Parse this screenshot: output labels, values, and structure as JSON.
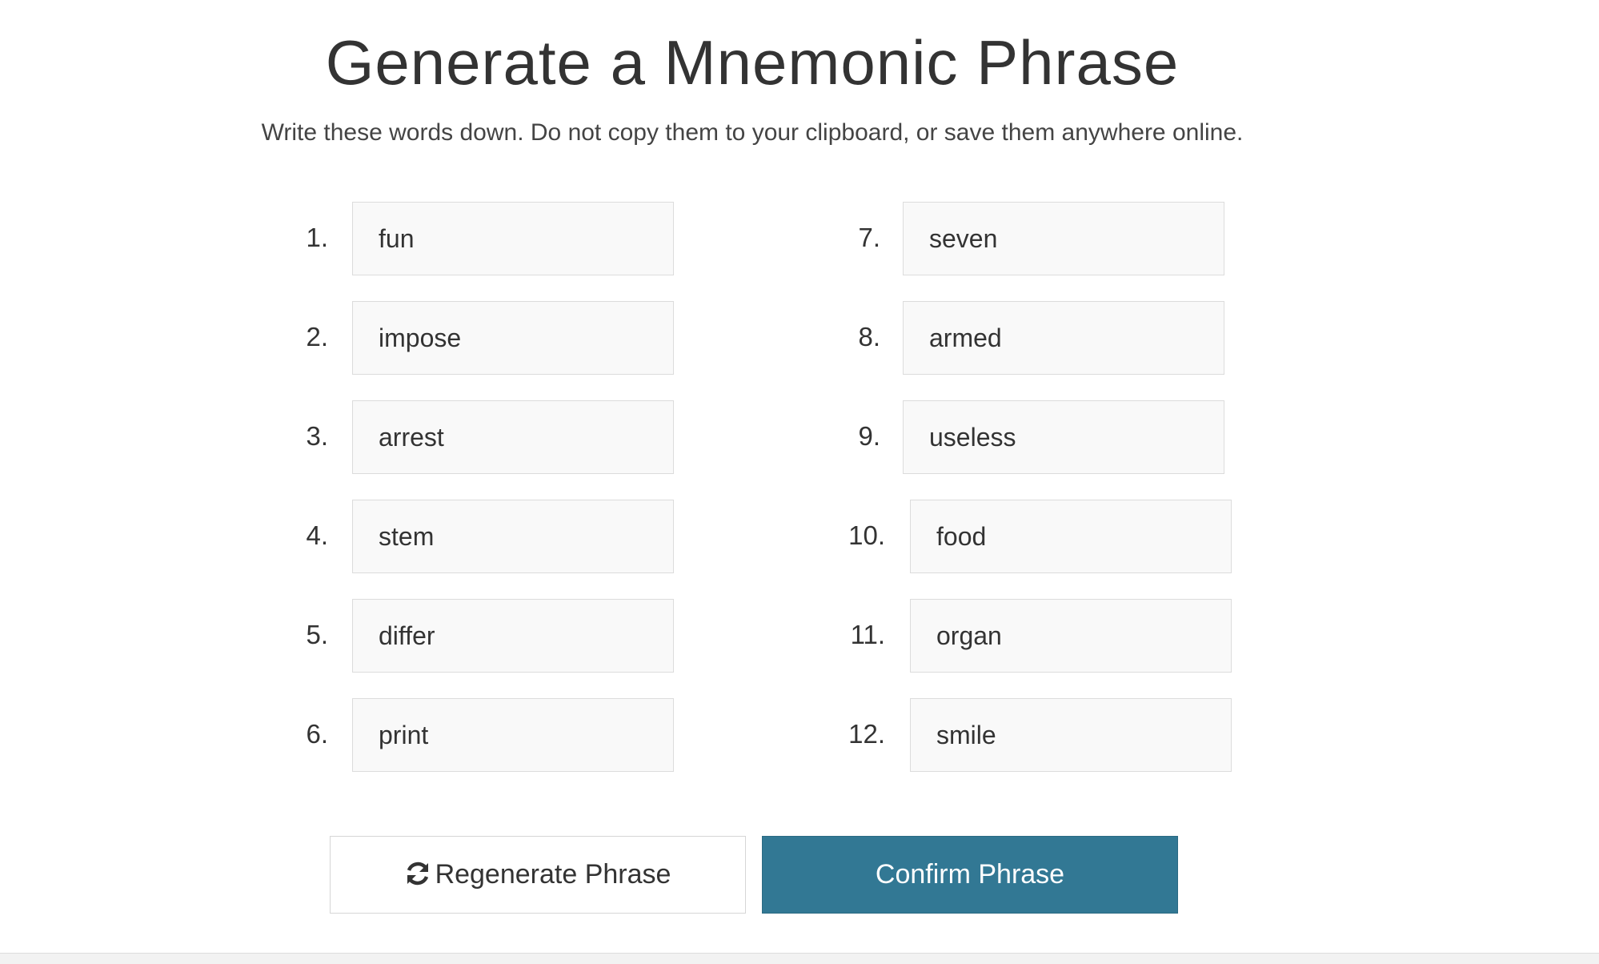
{
  "header": {
    "title": "Generate a Mnemonic Phrase",
    "subtitle": "Write these words down. Do not copy them to your clipboard, or save them anywhere online."
  },
  "words": [
    {
      "number": "1.",
      "word": "fun"
    },
    {
      "number": "2.",
      "word": "impose"
    },
    {
      "number": "3.",
      "word": "arrest"
    },
    {
      "number": "4.",
      "word": "stem"
    },
    {
      "number": "5.",
      "word": "differ"
    },
    {
      "number": "6.",
      "word": "print"
    },
    {
      "number": "7.",
      "word": "seven"
    },
    {
      "number": "8.",
      "word": "armed"
    },
    {
      "number": "9.",
      "word": "useless"
    },
    {
      "number": "10.",
      "word": "food"
    },
    {
      "number": "11.",
      "word": "organ"
    },
    {
      "number": "12.",
      "word": "smile"
    }
  ],
  "actions": {
    "regenerate_label": "Regenerate Phrase",
    "regenerate_icon": "refresh-icon",
    "confirm_label": "Confirm Phrase"
  },
  "colors": {
    "primary": "#327894",
    "field_background": "#f9f9f9",
    "text": "#333333"
  }
}
